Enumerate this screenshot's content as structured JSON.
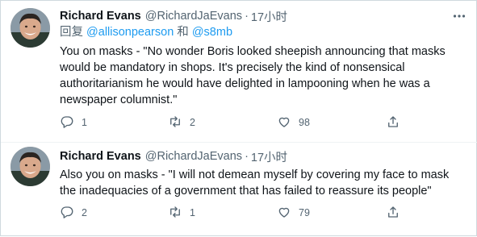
{
  "tweets": [
    {
      "author_name": "Richard Evans",
      "handle": "@RichardJaEvans",
      "separator": "·",
      "time": "17小时",
      "reply_prefix": "回复",
      "reply_to_1": "@allisonpearson",
      "reply_conj": "和",
      "reply_to_2": "@s8mb",
      "text_lines": [
        "You on masks - \"No wonder Boris looked sheepish announcing that masks",
        "would be mandatory in shops. It's precisely the kind of nonsensical",
        "authoritarianism he would have delighted in lampooning when he was a",
        "newspaper columnist.\""
      ],
      "reply_count": "1",
      "retweet_count": "2",
      "like_count": "98"
    },
    {
      "author_name": "Richard Evans",
      "handle": "@RichardJaEvans",
      "separator": "·",
      "time": "17小时",
      "text_lines": [
        "Also you on masks - \"I will not demean myself by covering my face to mask",
        "the inadequacies of a government that has failed to reassure its people\""
      ],
      "reply_count": "2",
      "retweet_count": "1",
      "like_count": "79"
    }
  ],
  "colors": {
    "text": "#0f1419",
    "secondary": "#536471",
    "link": "#1d9bf0",
    "border": "#cfd9de"
  },
  "icons": [
    "more-icon",
    "reply-icon",
    "retweet-icon",
    "like-icon",
    "share-icon"
  ]
}
